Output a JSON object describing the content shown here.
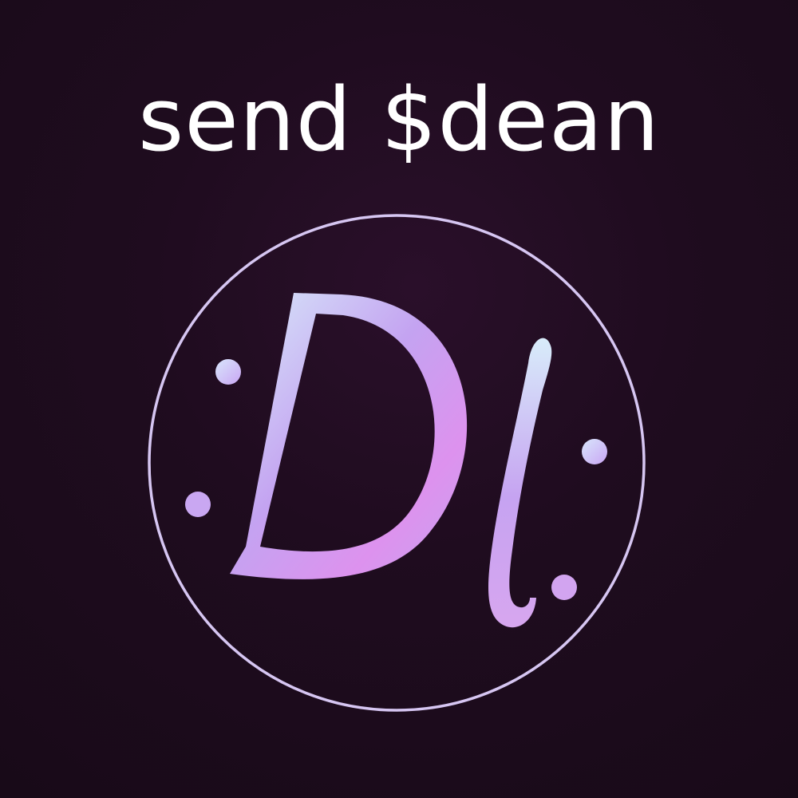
{
  "headline": {
    "text": "send $dean"
  },
  "logo": {
    "monogram": "Dl",
    "icon": "dl-monogram-logo",
    "colors": {
      "background": "#1f0c1f",
      "ring": "#d6c6f2",
      "gradient_light": "#d8ecfa",
      "gradient_mid": "#c9a2f2",
      "gradient_pink": "#e690ee"
    }
  }
}
